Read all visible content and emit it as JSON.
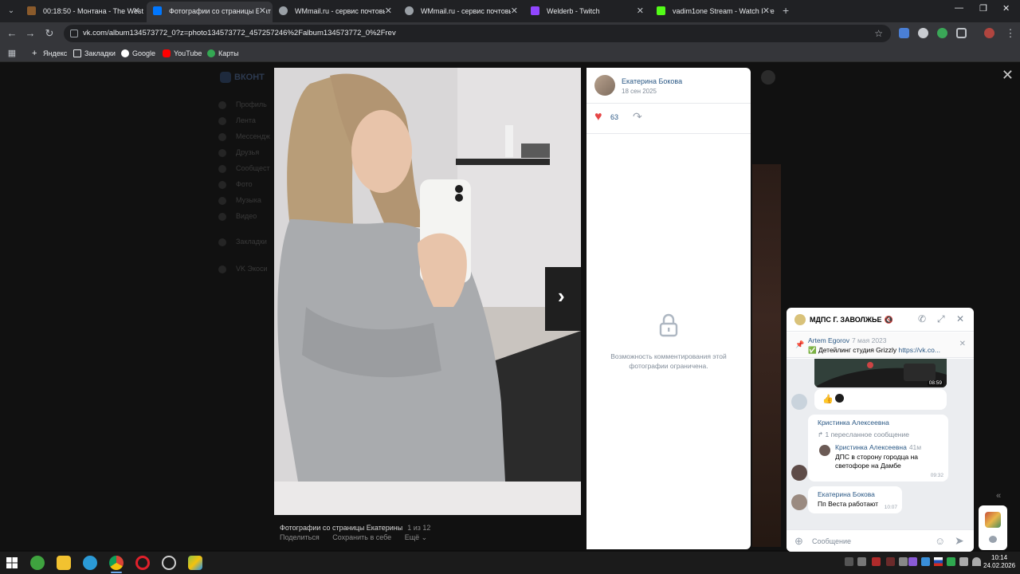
{
  "browser": {
    "tabs": [
      {
        "title": "00:18:50 - Монтана - The West",
        "favicon_color": "#8a5a2b",
        "active": false
      },
      {
        "title": "Фотографии со страницы Екат",
        "favicon_color": "#0077ff",
        "active": true
      },
      {
        "title": "WMmail.ru - сервис почтовы",
        "favicon_color": "#9aa0a6",
        "active": false
      },
      {
        "title": "WMmail.ru - сервис почтовых",
        "favicon_color": "#9aa0a6",
        "active": false
      },
      {
        "title": "Welderb - Twitch",
        "favicon_color": "#9146ff",
        "active": false
      },
      {
        "title": "vadim1one Stream - Watch Live",
        "favicon_color": "#53fc18",
        "active": false
      }
    ],
    "new_tab_label": "+",
    "url": "vk.com/album134573772_0?z=photo134573772_457257246%2Falbum134573772_0%2Frev",
    "bookmarks": [
      {
        "label": "Яндекс",
        "icon": "plus-icon",
        "color": "#e8eaed"
      },
      {
        "label": "Закладки",
        "icon": "folder-icon",
        "color": "#e8eaed"
      },
      {
        "label": "Google",
        "icon": "google-icon",
        "color": "#4285f4"
      },
      {
        "label": "YouTube",
        "icon": "youtube-icon",
        "color": "#ff0000"
      },
      {
        "label": "Карты",
        "icon": "maps-icon",
        "color": "#34a853"
      }
    ]
  },
  "vk_background": {
    "logo": "ВКОНТ",
    "nav": [
      "Профиль",
      "Лента",
      "Мессендж",
      "Друзья",
      "Сообщест",
      "Фото",
      "Музыка",
      "Видео",
      "Закладки",
      "VK Экоси"
    ]
  },
  "viewer": {
    "caption": "Фотографии со страницы Екатерины",
    "counter": "1 из 12",
    "actions": [
      "Поделиться",
      "Сохранить в себе",
      "Ещё ⌄"
    ],
    "author": "Екатерина Бокова",
    "date": "18 сен 2025",
    "likes": "63",
    "comments_restricted": "Возможность комментирования этой фотографии ограничена."
  },
  "chat": {
    "title": "МДПС Г. ЗАВОЛЖЬЕ",
    "muted_icon": "🔇",
    "pinned": {
      "author": "Artem Egorov",
      "date": "7 мая 2023",
      "text": "✅ Детейлинг студия Grizzly",
      "link": "https://vk.co..."
    },
    "video_duration": "08:59",
    "forward": {
      "from": "Кристинка Алексеевна",
      "note": "1 пересланное сообщение",
      "inner_name": "Кристинка Алексеевна",
      "inner_ago": "41м",
      "inner_text": "ДПС в сторону городца на светофоре на Дамбе",
      "time": "09:32"
    },
    "last": {
      "from": "Екатерина Бокова",
      "text": "Пп Веста работают",
      "time": "10:07"
    },
    "placeholder": "Сообщение"
  },
  "taskbar": {
    "time": "10:14",
    "date": "24.02.2026",
    "apps": [
      {
        "name": "start-icon",
        "color": "#ffffff"
      },
      {
        "name": "torrent-icon",
        "color": "#3fa33f"
      },
      {
        "name": "explorer-icon",
        "color": "#f2c230"
      },
      {
        "name": "edge-icon",
        "color": "#2b9ad6"
      },
      {
        "name": "chrome-icon",
        "color": "#e3b12d"
      },
      {
        "name": "opera-icon",
        "color": "#e0202b"
      },
      {
        "name": "steam-like-icon",
        "color": "#888888"
      },
      {
        "name": "bluestacks-icon",
        "color": "#8bc34a"
      }
    ]
  }
}
